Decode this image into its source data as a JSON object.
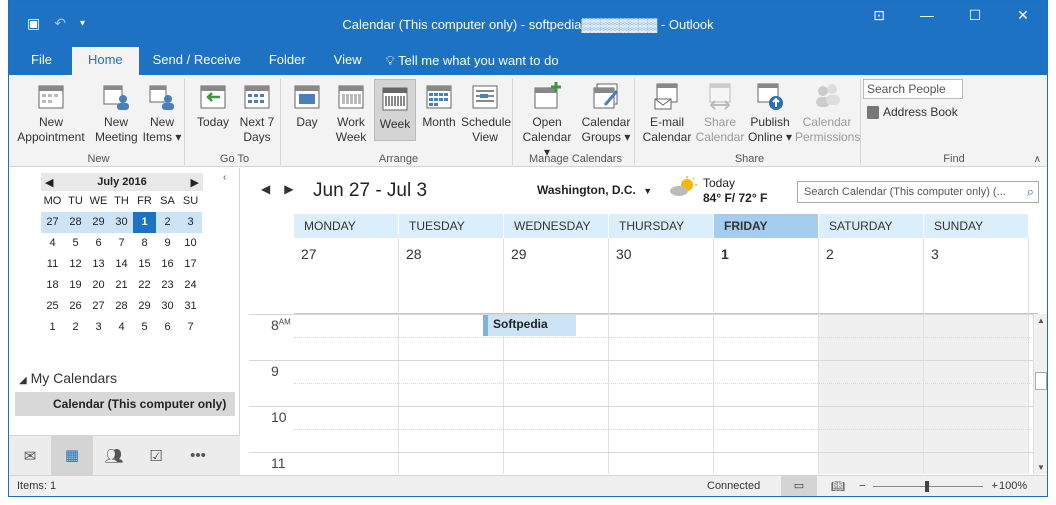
{
  "window": {
    "title": "Calendar (This computer only) - softpedia▓▓▓▓▓▓▓▓ - Outlook",
    "qat_icons": [
      "calendar-icon",
      "undo-icon",
      "customize-icon"
    ],
    "controls": [
      "ribbon-display-icon",
      "minimize-icon",
      "maximize-icon",
      "close-icon"
    ]
  },
  "menu": {
    "tabs": [
      "File",
      "Home",
      "Send / Receive",
      "Folder",
      "View"
    ],
    "active": "Home",
    "tell_me": "Tell me what you want to do"
  },
  "ribbon": {
    "new": {
      "name": "New",
      "appointment": "New\nAppointment",
      "meeting": "New\nMeeting",
      "items": "New\nItems ▾"
    },
    "goto": {
      "name": "Go To",
      "today": "Today",
      "next7": "Next 7\nDays"
    },
    "arrange": {
      "name": "Arrange",
      "day": "Day",
      "work_week": "Work\nWeek",
      "week": "Week",
      "month": "Month",
      "schedule": "Schedule\nView"
    },
    "manage": {
      "name": "Manage Calendars",
      "open": "Open\nCalendar ▾",
      "groups": "Calendar\nGroups ▾"
    },
    "share": {
      "name": "Share",
      "email": "E-mail\nCalendar",
      "share": "Share\nCalendar",
      "publish": "Publish\nOnline ▾",
      "permissions": "Calendar\nPermissions"
    },
    "find": {
      "name": "Find",
      "search_people": "Search People",
      "address_book": "Address Book"
    }
  },
  "minical": {
    "month": "July 2016",
    "dows": [
      "MO",
      "TU",
      "WE",
      "TH",
      "FR",
      "SA",
      "SU"
    ],
    "weeks": [
      [
        "27",
        "28",
        "29",
        "30",
        "1",
        "2",
        "3"
      ],
      [
        "4",
        "5",
        "6",
        "7",
        "8",
        "9",
        "10"
      ],
      [
        "11",
        "12",
        "13",
        "14",
        "15",
        "16",
        "17"
      ],
      [
        "18",
        "19",
        "20",
        "21",
        "22",
        "23",
        "24"
      ],
      [
        "25",
        "26",
        "27",
        "28",
        "29",
        "30",
        "31"
      ],
      [
        "1",
        "2",
        "3",
        "4",
        "5",
        "6",
        "7"
      ]
    ],
    "selected_week": 0,
    "today_index": 4
  },
  "folders": {
    "section": "My Calendars",
    "item": "Calendar (This computer only)"
  },
  "nav": [
    "mail-icon",
    "calendar-icon",
    "people-icon",
    "tasks-icon",
    "more-icon"
  ],
  "calendar": {
    "range": "Jun 27 - Jul 3",
    "location": "Washington, D.C.",
    "weather_day": "Today",
    "weather_temp": "84° F/ 72° F",
    "search_placeholder": "Search Calendar (This computer only) (...",
    "days": [
      "MONDAY",
      "TUESDAY",
      "WEDNESDAY",
      "THURSDAY",
      "FRIDAY",
      "SATURDAY",
      "SUNDAY"
    ],
    "dates": [
      "27",
      "28",
      "29",
      "30",
      "1",
      "2",
      "3"
    ],
    "current_day_index": 4,
    "hours": [
      {
        "h": "8",
        "ampm": "AM"
      },
      {
        "h": "9",
        "ampm": ""
      },
      {
        "h": "10",
        "ampm": ""
      },
      {
        "h": "11",
        "ampm": ""
      }
    ],
    "appointment": "Softpedia"
  },
  "status": {
    "items": "Items: 1",
    "connection": "Connected",
    "zoom": "100%",
    "zoom_minus": "−",
    "zoom_plus": "+"
  }
}
